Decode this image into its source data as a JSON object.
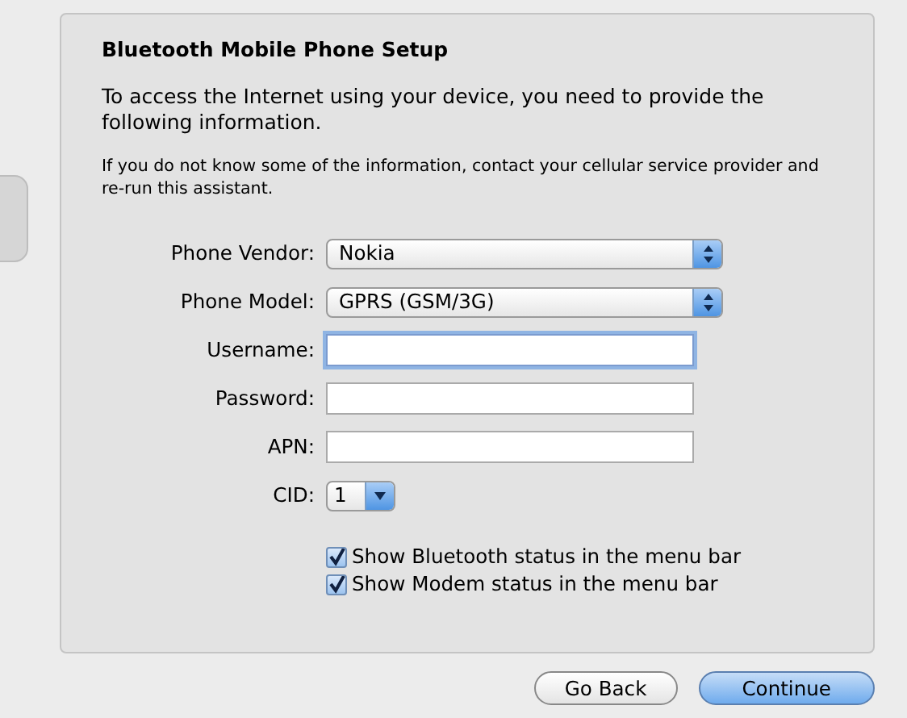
{
  "panel": {
    "title": "Bluetooth Mobile Phone Setup",
    "intro": "To access the Internet using your device, you need to provide the following information.",
    "note": "If you do not know some of the information, contact your cellular service provider and re-run this assistant."
  },
  "fields": [
    {
      "label": "Phone Vendor:",
      "kind": "popup",
      "value": "Nokia"
    },
    {
      "label": "Phone Model:",
      "kind": "popup",
      "value": "GPRS (GSM/3G)"
    },
    {
      "label": "Username:",
      "kind": "text",
      "focused": true
    },
    {
      "label": "Password:",
      "kind": "text",
      "focused": false
    },
    {
      "label": "APN:",
      "kind": "text",
      "focused": false
    },
    {
      "label": "CID:",
      "kind": "small_popup",
      "value": "1"
    }
  ],
  "checkboxes": [
    {
      "label": "Show Bluetooth status in the menu bar",
      "checked": true
    },
    {
      "label": "Show Modem status in the menu bar",
      "checked": true
    }
  ],
  "buttons": [
    {
      "label": "Go Back",
      "default": false
    },
    {
      "label": "Continue",
      "default": true
    }
  ]
}
